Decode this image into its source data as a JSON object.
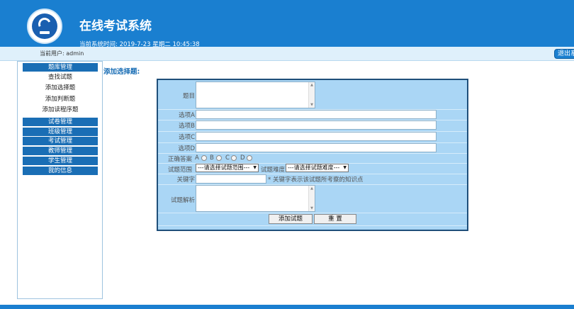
{
  "header": {
    "title": "在线考试系统",
    "time_label": "当前系统时间:",
    "time_value": "2019-7-23 星期二 10:45:38"
  },
  "userbar": {
    "user_label": "当前用户: admin",
    "logout_label": "退出系统"
  },
  "sidebar": {
    "question_bank": "题库管理",
    "sub_items": [
      "查找试题",
      "添加选择题",
      "添加判断题",
      "添加读程序题"
    ],
    "other_items": [
      "试卷管理",
      "班级管理",
      "考试管理",
      "教师管理",
      "学生管理",
      "我的信息"
    ]
  },
  "main": {
    "title": "添加选择题:"
  },
  "form": {
    "question_label": "题目",
    "option_a_label": "选项A",
    "option_b_label": "选项B",
    "option_c_label": "选项C",
    "option_d_label": "选项D",
    "answer_label": "正确答案",
    "answer_options": [
      "A",
      "B",
      "C",
      "D"
    ],
    "scope_label": "试题范围",
    "scope_select": "---请选择试题范围---",
    "difficulty_label": "试题难度",
    "difficulty_select": "---请选择试题难度---",
    "keyword_label": "关键字",
    "keyword_hint": "* 关键字表示该试题所考察的知识点",
    "analysis_label": "试题解析",
    "submit_label": "添加试题",
    "reset_label": "重 置"
  },
  "colors": {
    "brand_blue": "#1a7fd0",
    "form_bg": "#aad6f5",
    "sidebar_head": "#1a6eb5"
  }
}
